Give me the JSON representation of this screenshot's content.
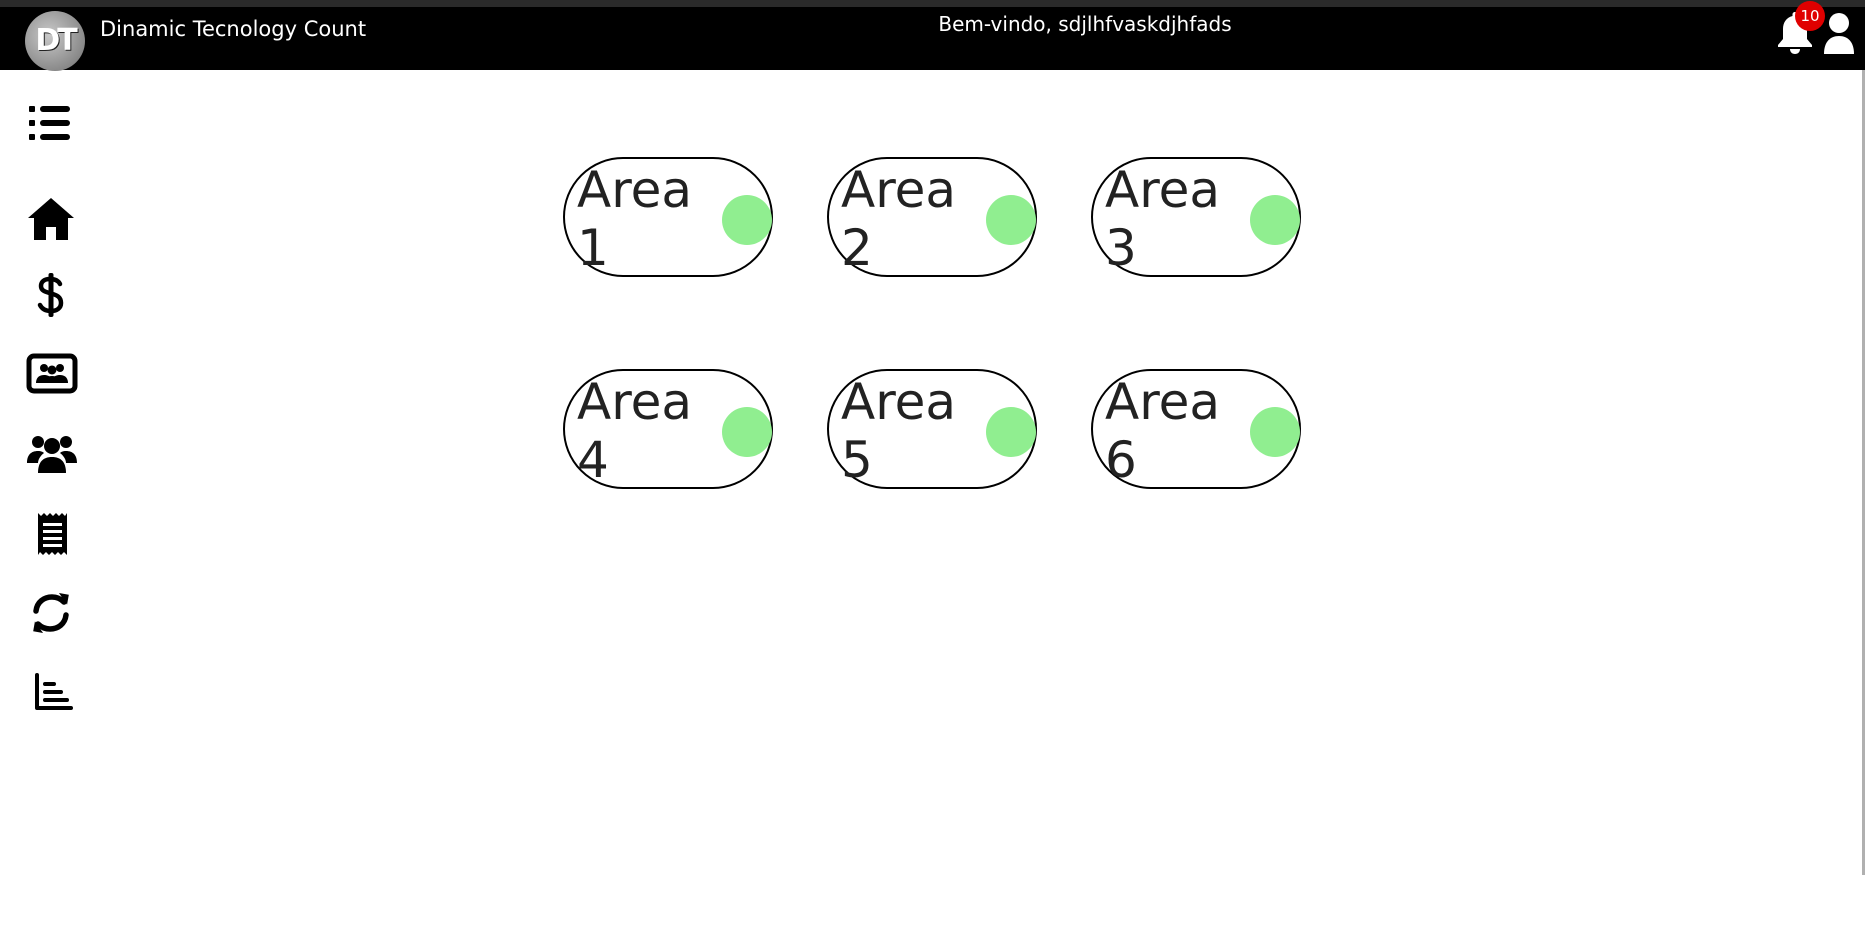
{
  "header": {
    "logo_text": "DT",
    "app_title": "Dinamic Tecnology Count",
    "welcome": "Bem-vindo, sdjlhfvaskdjhfads",
    "notifications_count": "10"
  },
  "sidebar": {
    "items": [
      {
        "name": "home",
        "icon": "home-icon"
      },
      {
        "name": "finance",
        "icon": "dollar-icon"
      },
      {
        "name": "id-card",
        "icon": "id-card-icon"
      },
      {
        "name": "users",
        "icon": "users-icon"
      },
      {
        "name": "receipt",
        "icon": "receipt-icon"
      },
      {
        "name": "sync",
        "icon": "sync-icon"
      },
      {
        "name": "reports",
        "icon": "bar-chart-icon"
      }
    ]
  },
  "areas": [
    {
      "label": "Area 1",
      "status_color": "#90ee90"
    },
    {
      "label": "Area 2",
      "status_color": "#90ee90"
    },
    {
      "label": "Area 3",
      "status_color": "#90ee90"
    },
    {
      "label": "Area 4",
      "status_color": "#90ee90"
    },
    {
      "label": "Area 5",
      "status_color": "#90ee90"
    },
    {
      "label": "Area 6",
      "status_color": "#90ee90"
    }
  ],
  "colors": {
    "header_bg": "#000000",
    "status_ok": "#90ee90",
    "badge": "#e00000"
  }
}
